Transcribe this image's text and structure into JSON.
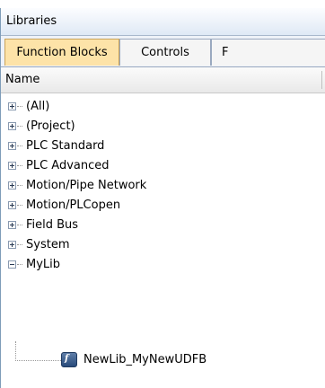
{
  "panel": {
    "title": "Libraries"
  },
  "tabs": [
    {
      "label": "Function Blocks",
      "active": true
    },
    {
      "label": "Controls",
      "active": false
    },
    {
      "label": "F",
      "active": false
    }
  ],
  "column": {
    "name": "Name"
  },
  "tree": [
    {
      "label": "(All)",
      "state": "collapsed"
    },
    {
      "label": "(Project)",
      "state": "collapsed"
    },
    {
      "label": "PLC Standard",
      "state": "collapsed"
    },
    {
      "label": "PLC Advanced",
      "state": "collapsed"
    },
    {
      "label": "Motion/Pipe Network",
      "state": "collapsed"
    },
    {
      "label": "Motion/PLCopen",
      "state": "collapsed"
    },
    {
      "label": "Field Bus",
      "state": "collapsed"
    },
    {
      "label": "System",
      "state": "collapsed"
    },
    {
      "label": "MyLib",
      "state": "expanded"
    }
  ],
  "child": {
    "label": "NewLib_MyNewUDFB",
    "icon": "function-block-icon"
  }
}
